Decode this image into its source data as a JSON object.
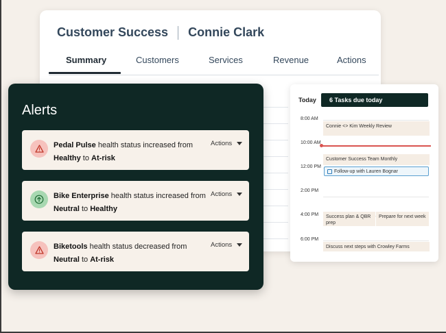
{
  "back_card": {
    "title_left": "Customer Success",
    "title_right": "Connie Clark",
    "tabs": [
      {
        "label": "Summary"
      },
      {
        "label": "Customers"
      },
      {
        "label": "Services"
      },
      {
        "label": "Revenue"
      },
      {
        "label": "Actions"
      }
    ],
    "active_tab": "Summary"
  },
  "alerts": {
    "title": "Alerts",
    "items": [
      {
        "company": "Pedal Pulse",
        "middle": " health status increased from ",
        "from": "Healthy",
        "to_word": " to ",
        "to": "At-risk",
        "actions": "Actions",
        "icon": "warning-icon",
        "icon_color": "#f6c2bd"
      },
      {
        "company": "Bike Enterprise",
        "middle": " health status increased from ",
        "from": "Neutral",
        "to_word": " to ",
        "to": "Healthy",
        "actions": "Actions",
        "icon": "arrow-up-circle-icon",
        "icon_color": "#a8d8b1"
      },
      {
        "company": "Biketools",
        "middle": " health status decreased from ",
        "from": "Neutral",
        "to_word": " to ",
        "to": "At-risk",
        "actions": "Actions",
        "icon": "warning-icon",
        "icon_color": "#f6c2bd"
      }
    ]
  },
  "calendar": {
    "today_label": "Today",
    "tasks_label": "6 Tasks due today",
    "times": [
      "8:00 AM",
      "10:00 AM",
      "12:00 PM",
      "2:00 PM",
      "4:00 PM",
      "6:00 PM"
    ],
    "events": [
      "Connie <> Kim Weekly Review",
      "Customer Success Team Monthly",
      "Follow-up with Lauren Bognar",
      "Success plan & QBR prep",
      "Prepare for next week",
      "Discuss next steps with Crowley Farms"
    ]
  },
  "colors": {
    "dark_panel": "#0f2825",
    "alert_bg": "#f7f1ea",
    "current_time": "#d9534f",
    "page_bg": "#f5f0ea"
  }
}
